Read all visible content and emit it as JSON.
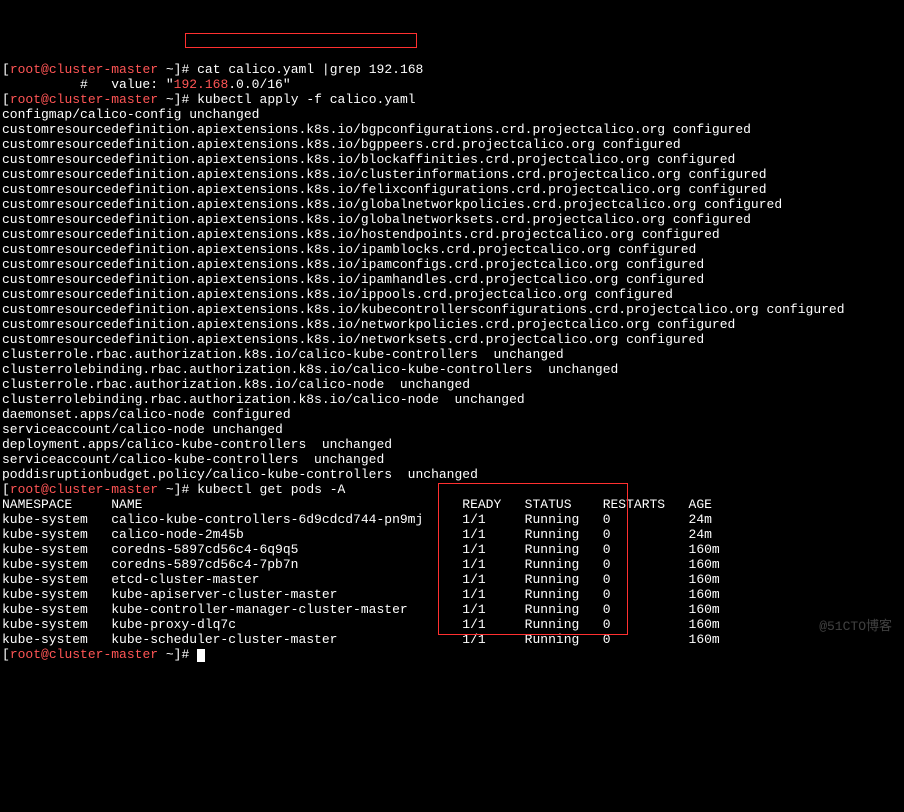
{
  "prompt": {
    "user": "root",
    "at": "@",
    "host": "cluster-master",
    "path": "~",
    "hash": "#"
  },
  "commands": {
    "cat_cmd": "cat calico.yaml |grep 192.168",
    "cat_output_prefix": "          #   value: \"",
    "cat_output_ip": "192.168",
    "cat_output_suffix": ".0.0/16\"",
    "apply_cmd": "kubectl apply -f calico.yaml",
    "get_pods_cmd": "kubectl get pods -A"
  },
  "apply_output": [
    "configmap/calico-config unchanged",
    "customresourcedefinition.apiextensions.k8s.io/bgpconfigurations.crd.projectcalico.org configured",
    "customresourcedefinition.apiextensions.k8s.io/bgppeers.crd.projectcalico.org configured",
    "customresourcedefinition.apiextensions.k8s.io/blockaffinities.crd.projectcalico.org configured",
    "customresourcedefinition.apiextensions.k8s.io/clusterinformations.crd.projectcalico.org configured",
    "customresourcedefinition.apiextensions.k8s.io/felixconfigurations.crd.projectcalico.org configured",
    "customresourcedefinition.apiextensions.k8s.io/globalnetworkpolicies.crd.projectcalico.org configured",
    "customresourcedefinition.apiextensions.k8s.io/globalnetworksets.crd.projectcalico.org configured",
    "customresourcedefinition.apiextensions.k8s.io/hostendpoints.crd.projectcalico.org configured",
    "customresourcedefinition.apiextensions.k8s.io/ipamblocks.crd.projectcalico.org configured",
    "customresourcedefinition.apiextensions.k8s.io/ipamconfigs.crd.projectcalico.org configured",
    "customresourcedefinition.apiextensions.k8s.io/ipamhandles.crd.projectcalico.org configured",
    "customresourcedefinition.apiextensions.k8s.io/ippools.crd.projectcalico.org configured",
    "customresourcedefinition.apiextensions.k8s.io/kubecontrollersconfigurations.crd.projectcalico.org configured",
    "customresourcedefinition.apiextensions.k8s.io/networkpolicies.crd.projectcalico.org configured",
    "customresourcedefinition.apiextensions.k8s.io/networksets.crd.projectcalico.org configured",
    "clusterrole.rbac.authorization.k8s.io/calico-kube-controllers  unchanged",
    "clusterrolebinding.rbac.authorization.k8s.io/calico-kube-controllers  unchanged",
    "clusterrole.rbac.authorization.k8s.io/calico-node  unchanged",
    "clusterrolebinding.rbac.authorization.k8s.io/calico-node  unchanged",
    "daemonset.apps/calico-node configured",
    "serviceaccount/calico-node unchanged",
    "deployment.apps/calico-kube-controllers  unchanged",
    "serviceaccount/calico-kube-controllers  unchanged",
    "poddisruptionbudget.policy/calico-kube-controllers  unchanged"
  ],
  "pods_table": {
    "headers": {
      "namespace": "NAMESPACE",
      "name": "NAME",
      "ready": "READY",
      "status": "STATUS",
      "restarts": "RESTARTS",
      "age": "AGE"
    },
    "rows": [
      {
        "ns": "kube-system",
        "name": "calico-kube-controllers-6d9cdcd744-pn9mj",
        "ready": "1/1",
        "status": "Running",
        "restarts": "0",
        "age": "24m"
      },
      {
        "ns": "kube-system",
        "name": "calico-node-2m45b",
        "ready": "1/1",
        "status": "Running",
        "restarts": "0",
        "age": "24m"
      },
      {
        "ns": "kube-system",
        "name": "coredns-5897cd56c4-6q9q5",
        "ready": "1/1",
        "status": "Running",
        "restarts": "0",
        "age": "160m"
      },
      {
        "ns": "kube-system",
        "name": "coredns-5897cd56c4-7pb7n",
        "ready": "1/1",
        "status": "Running",
        "restarts": "0",
        "age": "160m"
      },
      {
        "ns": "kube-system",
        "name": "etcd-cluster-master",
        "ready": "1/1",
        "status": "Running",
        "restarts": "0",
        "age": "160m"
      },
      {
        "ns": "kube-system",
        "name": "kube-apiserver-cluster-master",
        "ready": "1/1",
        "status": "Running",
        "restarts": "0",
        "age": "160m"
      },
      {
        "ns": "kube-system",
        "name": "kube-controller-manager-cluster-master",
        "ready": "1/1",
        "status": "Running",
        "restarts": "0",
        "age": "160m"
      },
      {
        "ns": "kube-system",
        "name": "kube-proxy-dlq7c",
        "ready": "1/1",
        "status": "Running",
        "restarts": "0",
        "age": "160m"
      },
      {
        "ns": "kube-system",
        "name": "kube-scheduler-cluster-master",
        "ready": "1/1",
        "status": "Running",
        "restarts": "0",
        "age": "160m"
      }
    ]
  },
  "prompt_render": {
    "open": "[",
    "close": "]",
    "tilde": " ~",
    "sep": " "
  },
  "watermark": "@51CTO博客"
}
